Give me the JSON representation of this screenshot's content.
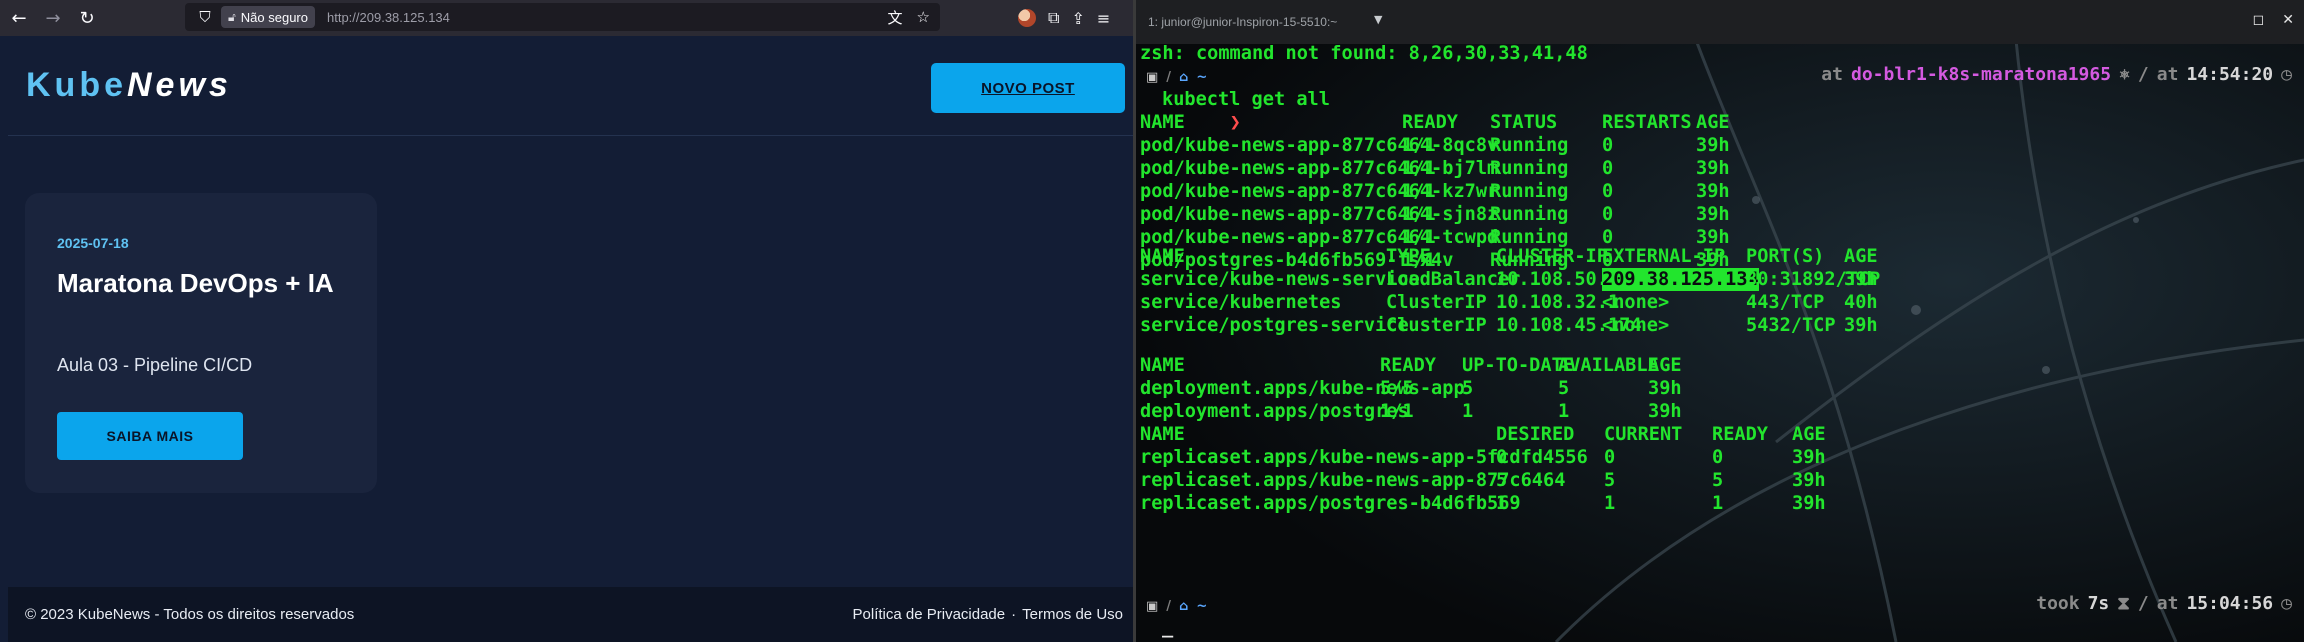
{
  "browser": {
    "security_label": "Não seguro",
    "url": "http://209.38.125.134",
    "site": {
      "logo_kube": "Kube",
      "logo_news": "News",
      "new_post_label": "NOVO POST",
      "post": {
        "date": "2025-07-18",
        "title": "Maratona DevOps + IA",
        "subtitle": "Aula 03 - Pipeline CI/CD",
        "cta_label": "SAIBA MAIS"
      },
      "footer": {
        "copyright": "© 2023 KubeNews - Todos os direitos reservados",
        "privacy": "Política de Privacidade",
        "separator": "·",
        "terms": "Termos de Uso"
      }
    }
  },
  "terminal": {
    "title": "1: junior@junior-Inspiron-15-5510:~",
    "error_line": "zsh: command not found: 8,26,30,33,41,48",
    "prompt_context": {
      "at1": "at",
      "cluster": "do-blr1-k8s-maratona1965",
      "sep": "/",
      "at2": "at",
      "time": "14:54:20"
    },
    "prompt_symbol": "❯",
    "command": "kubectl get all",
    "pods": {
      "headers": [
        "NAME",
        "READY",
        "STATUS",
        "RESTARTS",
        "AGE"
      ],
      "rows": [
        [
          "pod/kube-news-app-877c6464-8qc8v",
          "1/1",
          "Running",
          "0",
          "39h"
        ],
        [
          "pod/kube-news-app-877c6464-bj7lm",
          "1/1",
          "Running",
          "0",
          "39h"
        ],
        [
          "pod/kube-news-app-877c6464-kz7wr",
          "1/1",
          "Running",
          "0",
          "39h"
        ],
        [
          "pod/kube-news-app-877c6464-sjn8z",
          "1/1",
          "Running",
          "0",
          "39h"
        ],
        [
          "pod/kube-news-app-877c6464-tcwpd",
          "1/1",
          "Running",
          "0",
          "39h"
        ],
        [
          "pod/postgres-b4d6fb569-fsx4v",
          "1/1",
          "Running",
          "0",
          "39h"
        ]
      ]
    },
    "services": {
      "headers": [
        "NAME",
        "TYPE",
        "CLUSTER-IP",
        "EXTERNAL-IP",
        "PORT(S)",
        "AGE"
      ],
      "rows": [
        [
          "service/kube-news-service",
          "LoadBalancer",
          "10.108.50.176",
          "209.38.125.134",
          "80:31892/TCP",
          "39h"
        ],
        [
          "service/kubernetes",
          "ClusterIP",
          "10.108.32.1",
          "<none>",
          "443/TCP",
          "40h"
        ],
        [
          "service/postgres-service",
          "ClusterIP",
          "10.108.45.174",
          "<none>",
          "5432/TCP",
          "39h"
        ]
      ]
    },
    "deployments": {
      "headers": [
        "NAME",
        "READY",
        "UP-TO-DATE",
        "AVAILABLE",
        "AGE"
      ],
      "rows": [
        [
          "deployment.apps/kube-news-app",
          "5/5",
          "5",
          "5",
          "39h"
        ],
        [
          "deployment.apps/postgres",
          "1/1",
          "1",
          "1",
          "39h"
        ]
      ]
    },
    "replicasets": {
      "headers": [
        "NAME",
        "DESIRED",
        "CURRENT",
        "READY",
        "AGE"
      ],
      "rows": [
        [
          "replicaset.apps/kube-news-app-5fcdfd4556",
          "0",
          "0",
          "0",
          "39h"
        ],
        [
          "replicaset.apps/kube-news-app-877c6464",
          "5",
          "5",
          "5",
          "39h"
        ],
        [
          "replicaset.apps/postgres-b4d6fb569",
          "1",
          "1",
          "1",
          "39h"
        ]
      ]
    },
    "footer_prompt": {
      "took": "took",
      "duration": "7s",
      "sep": "/",
      "at": "at",
      "time": "15:04:56"
    },
    "cursor": "_"
  }
}
